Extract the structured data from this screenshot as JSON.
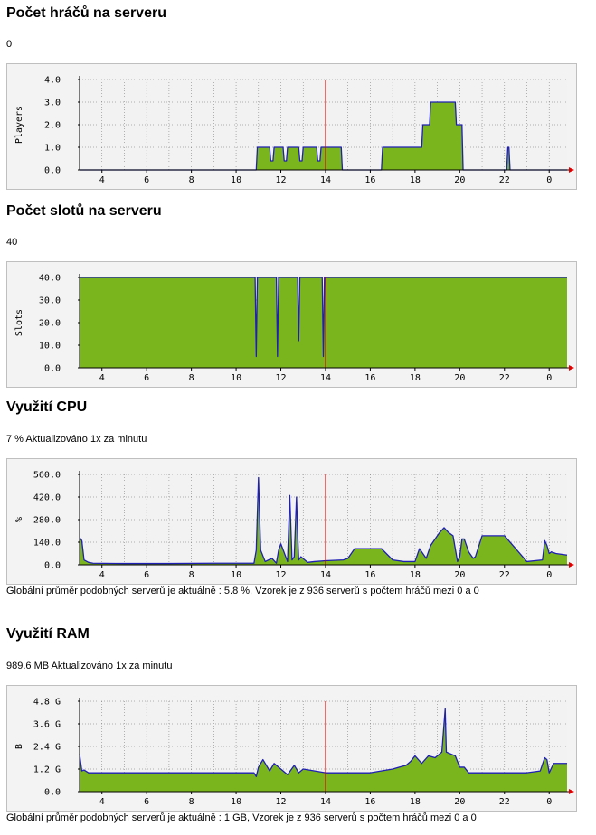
{
  "sections": [
    {
      "title": "Počet hráčů na serveru",
      "value": "0",
      "note": ""
    },
    {
      "title": "Počet slotů na serveru",
      "value": "40",
      "note": ""
    },
    {
      "title": "Využití CPU",
      "value": "7 % Aktualizováno 1x za minutu",
      "note": "Globální průměr podobných serverů je aktuálně : 5.8 %, Vzorek je z 936 serverů s počtem hráčů mezi 0 a 0"
    },
    {
      "title": "Využití RAM",
      "value": "989.6 MB Aktualizováno 1x za minutu",
      "note": "Globální průměr podobných serverů je aktuálně : 1 GB, Vzorek je z 936 serverů s počtem hráčů mezi 0 a 0"
    }
  ],
  "colors": {
    "fill": "#7ab51d",
    "line": "#1f1fb4",
    "now_marker": "#cc0000",
    "plot_bg": "#f2f2f2",
    "frame_bg": "#f3f3f3"
  },
  "chart_data": [
    {
      "type": "area",
      "ylabel": "Players",
      "ylim": [
        0,
        4
      ],
      "yticks": [
        "0.0",
        "1.0",
        "2.0",
        "3.0",
        "4.0"
      ],
      "xlim": [
        3,
        24.8
      ],
      "xticks": [
        "4",
        "6",
        "8",
        "10",
        "12",
        "14",
        "16",
        "18",
        "20",
        "22",
        "0",
        "2",
        "4",
        "6",
        "8",
        "10",
        "12",
        "14",
        "16",
        "18",
        "20",
        "22"
      ],
      "now_x": 14,
      "x": [
        3,
        10.9,
        10.95,
        11.5,
        11.55,
        11.65,
        11.7,
        12.1,
        12.15,
        12.25,
        12.3,
        12.8,
        12.85,
        12.95,
        13.0,
        13.6,
        13.65,
        13.75,
        13.8,
        14.7,
        14.75,
        16.5,
        16.55,
        18.3,
        18.35,
        18.4,
        18.45,
        18.65,
        18.7,
        18.75,
        18.85,
        19.8,
        19.85,
        20.1,
        20.15,
        22.1,
        22.15,
        22.2,
        22.25,
        23.7,
        23.75,
        24.8
      ],
      "y": [
        0,
        0,
        1,
        1,
        0.4,
        0.4,
        1,
        1,
        0.4,
        0.4,
        1,
        1,
        0.4,
        0.4,
        1,
        1,
        0.4,
        0.4,
        1,
        1,
        0,
        0,
        1,
        1,
        2,
        2,
        2,
        2,
        3,
        3,
        3,
        3,
        2,
        2,
        0,
        0,
        1,
        1,
        0,
        0,
        0,
        0
      ]
    },
    {
      "type": "area",
      "ylabel": "Slots",
      "ylim": [
        0,
        40
      ],
      "yticks": [
        "0.0",
        "10.0",
        "20.0",
        "30.0",
        "40.0"
      ],
      "xlim": [
        3,
        24.8
      ],
      "xticks": [
        "4",
        "6",
        "8",
        "10",
        "12",
        "14",
        "16",
        "18",
        "20",
        "22",
        "0",
        "2",
        "4",
        "6",
        "8",
        "10",
        "12",
        "14",
        "16",
        "18",
        "20",
        "22"
      ],
      "now_x": 14,
      "x": [
        3,
        10.85,
        10.9,
        10.95,
        11.8,
        11.85,
        11.9,
        12.75,
        12.8,
        12.85,
        13.85,
        13.9,
        13.95,
        14.0,
        24.8
      ],
      "y": [
        40,
        40,
        5,
        40,
        40,
        5,
        40,
        40,
        12,
        40,
        40,
        5,
        40,
        40,
        40
      ]
    },
    {
      "type": "area",
      "ylabel": "%",
      "ylim": [
        0,
        560
      ],
      "yticks": [
        "0.0",
        "140.0",
        "280.0",
        "420.0",
        "560.0"
      ],
      "xlim": [
        3,
        24.8
      ],
      "xticks": [
        "4",
        "6",
        "8",
        "10",
        "12",
        "14",
        "16",
        "18",
        "20",
        "22",
        "0",
        "2",
        "4",
        "6",
        "8",
        "10",
        "12",
        "14",
        "16",
        "18",
        "20",
        "22"
      ],
      "now_x": 14,
      "x": [
        3,
        3.1,
        3.2,
        3.4,
        3.6,
        5.0,
        7.0,
        9.0,
        10.8,
        10.9,
        11.0,
        11.1,
        11.3,
        11.6,
        11.8,
        11.9,
        12.0,
        12.3,
        12.4,
        12.5,
        12.6,
        12.7,
        12.75,
        12.8,
        12.9,
        13.2,
        13.5,
        14.0,
        14.8,
        15.0,
        15.3,
        16.0,
        16.5,
        17.0,
        17.5,
        18.0,
        18.2,
        18.5,
        18.7,
        18.9,
        19.1,
        19.3,
        19.5,
        19.7,
        19.9,
        20.0,
        20.1,
        20.2,
        20.4,
        20.6,
        20.7,
        21.0,
        22.0,
        23.0,
        23.7,
        23.8,
        23.9,
        24.0,
        24.1,
        24.3,
        24.8
      ],
      "y": [
        170,
        150,
        30,
        15,
        10,
        8,
        8,
        10,
        10,
        90,
        540,
        90,
        20,
        40,
        10,
        90,
        130,
        20,
        430,
        30,
        50,
        420,
        200,
        30,
        50,
        15,
        20,
        25,
        30,
        40,
        100,
        100,
        100,
        30,
        20,
        20,
        100,
        40,
        120,
        160,
        200,
        230,
        200,
        180,
        20,
        50,
        160,
        160,
        80,
        40,
        50,
        180,
        180,
        20,
        30,
        150,
        120,
        70,
        80,
        70,
        60
      ]
    },
    {
      "type": "area",
      "ylabel": "B",
      "ylim": [
        0,
        4.8
      ],
      "yticks": [
        "0.0",
        "1.2 G",
        "2.4 G",
        "3.6 G",
        "4.8 G"
      ],
      "xlim": [
        3,
        24.8
      ],
      "xticks": [
        "4",
        "6",
        "8",
        "10",
        "12",
        "14",
        "16",
        "18",
        "20",
        "22",
        "0",
        "2",
        "4",
        "6",
        "8",
        "10",
        "12",
        "14",
        "16",
        "18",
        "20",
        "22"
      ],
      "now_x": 14,
      "x": [
        3,
        3.1,
        3.2,
        3.4,
        4.0,
        6.0,
        8.0,
        10.0,
        10.8,
        10.9,
        11.0,
        11.2,
        11.5,
        11.7,
        12.0,
        12.3,
        12.6,
        12.8,
        13.0,
        14.0,
        16.0,
        17.0,
        17.3,
        17.6,
        17.8,
        18.0,
        18.3,
        18.6,
        18.9,
        19.0,
        19.2,
        19.35,
        19.4,
        19.6,
        19.8,
        20.0,
        20.2,
        20.4,
        20.6,
        22.0,
        23.0,
        23.6,
        23.8,
        23.9,
        24.0,
        24.2,
        24.8
      ],
      "y": [
        2.0,
        1.1,
        1.15,
        1.0,
        1.0,
        1.0,
        1.0,
        1.0,
        1.0,
        0.8,
        1.3,
        1.7,
        1.1,
        1.5,
        1.2,
        0.9,
        1.4,
        1.0,
        1.2,
        1.0,
        1.0,
        1.2,
        1.3,
        1.4,
        1.6,
        1.9,
        1.5,
        1.9,
        1.8,
        1.9,
        2.1,
        4.4,
        2.1,
        2.0,
        1.9,
        1.3,
        1.3,
        1.0,
        1.0,
        1.0,
        1.0,
        1.1,
        1.8,
        1.7,
        1.0,
        1.5,
        1.5
      ]
    }
  ]
}
